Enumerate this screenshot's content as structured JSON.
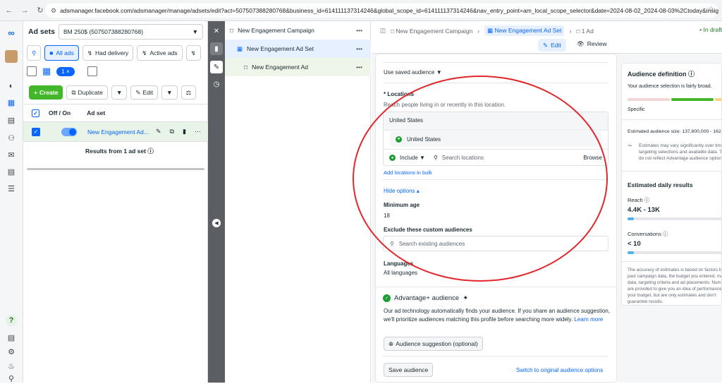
{
  "browser": {
    "url": "adsmanager.facebook.com/adsmanager/manage/adsets/edit?act=507507388280768&business_id=614111137314246&global_scope_id=614111137314246&nav_entry_point=am_local_scope_selector&date=2024-08-02_2024-08-03%2Ctoday&insigh..."
  },
  "adsets": {
    "title": "Ad sets",
    "account": "BM 250$ (507507388280768)",
    "filters": [
      "All ads",
      "Had delivery",
      "Active ads"
    ],
    "selected_count": "1",
    "create_label": "Create",
    "duplicate_label": "Duplicate",
    "edit_label": "Edit",
    "col_offon": "Off / On",
    "col_adset": "Ad set",
    "row_name": "New Engagement Ad...",
    "results": "Results from 1 ad set"
  },
  "tree": {
    "campaign": "New Engagement Campaign",
    "adset": "New Engagement Ad Set",
    "ad": "New Engagement Ad",
    "more": "•••"
  },
  "editor": {
    "crumb_campaign": "New Engagement Campaign",
    "crumb_adset": "New Engagement Ad Set",
    "crumb_ad": "1 Ad",
    "status": "In draft",
    "edit_label": "Edit",
    "review_label": "Review",
    "saved_audience": "Use saved audience",
    "locations_title": "* Locations",
    "locations_sub": "Reach people living in or recently in this location.",
    "loc_country_head": "United States",
    "loc_item": "United States",
    "include_label": "Include",
    "search_locations": "Search locations",
    "browse_label": "Browse",
    "bulk_link": "Add locations in bulk",
    "hide_options": "Hide options",
    "min_age_label": "Minimum age",
    "min_age_value": "18",
    "exclude_label": "Exclude these custom audiences",
    "search_existing": "Search existing audiences",
    "languages_label": "Languages",
    "languages_value": "All languages",
    "advplus_title": "Advantage+ audience",
    "advplus_desc": "Our ad technology automatically finds your audience. If you share an audience suggestion, we'll prioritize audiences matching this profile before searching more widely.",
    "learn_more": "Learn more",
    "audience_suggestion": "Audience suggestion (optional)",
    "save_audience": "Save audience",
    "switch_link": "Switch to original audience options"
  },
  "definition": {
    "title": "Audience definition",
    "desc": "Your audience selection is fairly broad.",
    "specific": "Specific",
    "est_size": "Estimated audience size: 137,800,000 - 162",
    "note": "Estimates may vary significantly over time based on your targeting selections and available data. These numbers do not reflect Advantage audience options.",
    "daily_title": "Estimated daily results",
    "reach_label": "Reach",
    "reach_value": "4.4K - 13K",
    "conv_label": "Conversations",
    "conv_value": "< 10",
    "footer": "The accuracy of estimates is based on factors like past campaign data, the budget you entered, market data, targeting criteria and ad placements. Numbers are provided to give you an idea of performance for your budget, but are only estimates and don't guarantee results."
  }
}
